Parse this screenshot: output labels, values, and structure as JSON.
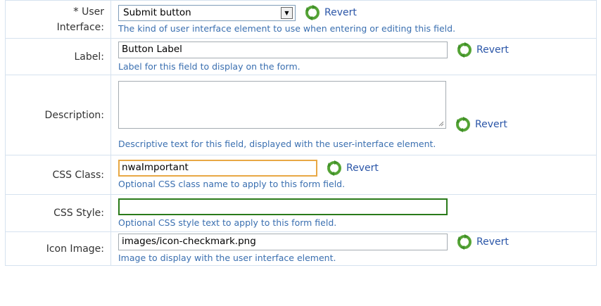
{
  "revert_label": "Revert",
  "icons": {
    "revert": "revert-refresh-icon",
    "dropdown": "chevron-down-icon"
  },
  "colors": {
    "help_text": "#3a6fb0",
    "revert_text": "#2b56a8",
    "focus_orange": "#e8a845",
    "focus_green": "#2a7a1a"
  },
  "fields": {
    "user_interface": {
      "required_mark": "*",
      "label_line1": "User",
      "label_line2": "Interface:",
      "value": "Submit button",
      "help": "The kind of user interface element to use when entering or editing this field."
    },
    "label": {
      "label": "Label:",
      "value": "Button Label",
      "help": "Label for this field to display on the form."
    },
    "description": {
      "label": "Description:",
      "value": "",
      "help": "Descriptive text for this field, displayed with the user-interface element."
    },
    "css_class": {
      "label": "CSS Class:",
      "value": "nwaImportant",
      "help": "Optional CSS class name to apply to this form field."
    },
    "css_style": {
      "label": "CSS Style:",
      "value": "",
      "help": "Optional CSS style text to apply to this form field."
    },
    "icon_image": {
      "label": "Icon Image:",
      "value": "images/icon-checkmark.png",
      "help": "Image to display with the user interface element."
    }
  }
}
